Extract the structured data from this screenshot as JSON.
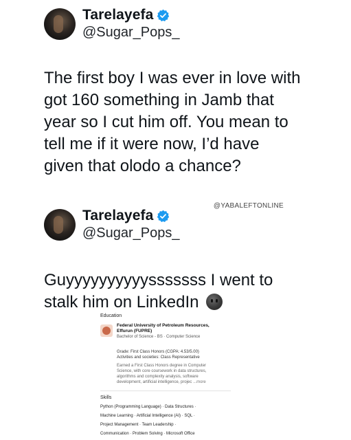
{
  "tweet1": {
    "display_name": "Tarelayefa",
    "handle": "@Sugar_Pops_",
    "text_lines": [
      "The first boy I was ever in love with",
      "got 160 something in Jamb that",
      "year so I cut him off. You mean to",
      "tell me if it were now, I’d have",
      "given that olodo a chance?"
    ]
  },
  "watermark": "@YABALEFTONLINE",
  "tweet2": {
    "display_name": "Tarelayefa",
    "handle": "@Sugar_Pops_",
    "text_lines": [
      "Guyyyyyyyyyysssssss I went to",
      "stalk him on LinkedIn"
    ],
    "emoji": "dark-moon-face-emoji"
  },
  "linkedin": {
    "education_title": "Education",
    "school": "Federal University of Petroleum Resources,",
    "school_line2": "Effurun (FUPRE)",
    "degree": "Bachelor of Science - BS · Computer Science",
    "grade": "Grade: First Class Honors (CGPA: 4.53/5.00)",
    "activities": "Activities and societies: Class Representative",
    "desc_lines": [
      "Earned a First Class Honors degree in Computer",
      "Science, with core coursework in data structures,",
      "algorithms and complexity analysis, software",
      "development, artificial intelligence, projec"
    ],
    "more": "...more",
    "skills_title": "Skills",
    "skills_rows": [
      "Python (Programming Language) · Data Structures ·",
      "Machine Learning · Artificial Intelligence (AI) · SQL ·",
      "Project Management · Team Leadership ·",
      "Communication · Problem Solving · Microsoft Office"
    ]
  },
  "colors": {
    "verified": "#1d9bf0",
    "text": "#0f1419"
  }
}
